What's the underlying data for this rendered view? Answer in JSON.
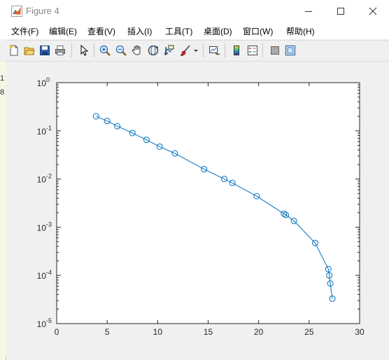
{
  "window": {
    "title": "Figure 4",
    "icon": "matlab-logo-icon"
  },
  "background_editor": {
    "line_numbers": [
      "1",
      "8"
    ]
  },
  "menu": [
    {
      "label": "文件(F)"
    },
    {
      "label": "编辑(E)"
    },
    {
      "label": "查看(V)"
    },
    {
      "label": "插入(I)"
    },
    {
      "label": "工具(T)"
    },
    {
      "label": "桌面(D)"
    },
    {
      "label": "窗口(W)"
    },
    {
      "label": "帮助(H)"
    }
  ],
  "toolbar": {
    "icons": [
      "new-figure-icon",
      "open-file-icon",
      "save-icon",
      "print-icon",
      "select-arrow-icon",
      "zoom-in-icon",
      "zoom-out-icon",
      "pan-hand-icon",
      "rotate-3d-icon",
      "data-cursor-icon",
      "brush-icon",
      "brush-dropdown-icon",
      "link-plot-icon",
      "insert-colorbar-icon",
      "insert-legend-icon",
      "hide-plot-tools-icon",
      "show-plot-tools-icon"
    ]
  },
  "colors": {
    "series": "#0072BD",
    "axes_background": "#ffffff",
    "figure_background": "#f0f0f0"
  },
  "chart_data": {
    "type": "line",
    "title": "",
    "xlabel": "",
    "ylabel": "",
    "xscale": "linear",
    "yscale": "log",
    "xlim": [
      0,
      30
    ],
    "ylim": [
      1e-05,
      1
    ],
    "grid": false,
    "marker": "circle",
    "x_ticks": [
      0,
      5,
      10,
      15,
      20,
      25,
      30
    ],
    "x_tick_labels": [
      "0",
      "5",
      "10",
      "15",
      "20",
      "25",
      "30"
    ],
    "y_ticks": [
      1e-05,
      0.0001,
      0.001,
      0.01,
      0.1,
      1
    ],
    "y_tick_labels": [
      {
        "base": "10",
        "exp": "-5"
      },
      {
        "base": "10",
        "exp": "-4"
      },
      {
        "base": "10",
        "exp": "-3"
      },
      {
        "base": "10",
        "exp": "-2"
      },
      {
        "base": "10",
        "exp": "-1"
      },
      {
        "base": "10",
        "exp": "0"
      }
    ],
    "series": [
      {
        "x": [
          3.9,
          5.0,
          6.0,
          7.5,
          8.9,
          10.2,
          11.7,
          14.6,
          16.6,
          17.4,
          19.8,
          22.5,
          22.7,
          23.5,
          25.6,
          26.9,
          27.0,
          27.1,
          27.3
        ],
        "y": [
          0.2,
          0.16,
          0.125,
          0.09,
          0.065,
          0.047,
          0.034,
          0.016,
          0.01,
          0.0083,
          0.0044,
          0.0019,
          0.0018,
          0.00135,
          0.00047,
          0.000135,
          0.0001,
          6.8e-05,
          3.3e-05
        ]
      }
    ]
  }
}
